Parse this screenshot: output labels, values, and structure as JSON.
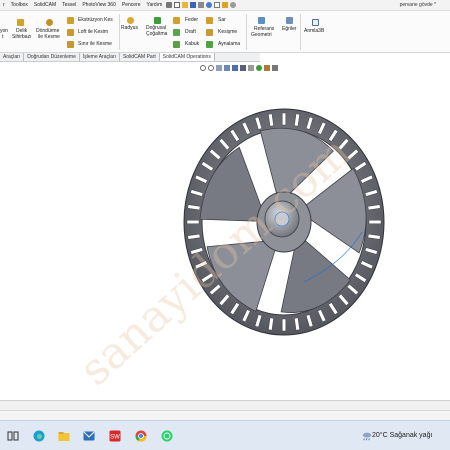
{
  "menubar": {
    "items": [
      "r",
      "Toolbox",
      "SolidCAM",
      "Tessel",
      "PhotoView 360",
      "Pencere",
      "Yardım"
    ],
    "doc_title": "pervane gövde *"
  },
  "ribbon": {
    "col1": [
      "yon",
      "t"
    ],
    "delik": [
      "Delik",
      "Sihirbazı"
    ],
    "dondurme": [
      "Döndürme",
      "ile Kesme"
    ],
    "cuts": [
      "Ekstrüzyon Kes",
      "Loft ile Kesim",
      "Sınır ile Kesme"
    ],
    "radyus": "Radyus",
    "dogrusal": [
      "Doğrusal",
      "Çoğaltma"
    ],
    "mid": [
      "Feder",
      "Draft",
      "Kabuk"
    ],
    "right": [
      "Sar",
      "Kesişme",
      "Aynalama"
    ],
    "referans": [
      "Referans",
      "Geometri"
    ],
    "egriler": "Eğriler",
    "anm": "Anmla3B"
  },
  "cmdtabs": [
    "Araçları",
    "Doğrudan Düzenleme",
    "İşleme Araçları",
    "SolidCAM Part",
    "SolidCAM Operations"
  ],
  "taskbar": {
    "weather_temp": "20°C",
    "weather_text": "Sağanak yağı"
  },
  "watermark": "sanayidom.com",
  "colors": {
    "part": "#6e7078",
    "part_light": "#a9abb3",
    "part_dark": "#3f4148",
    "accent": "#1c6fd1"
  }
}
